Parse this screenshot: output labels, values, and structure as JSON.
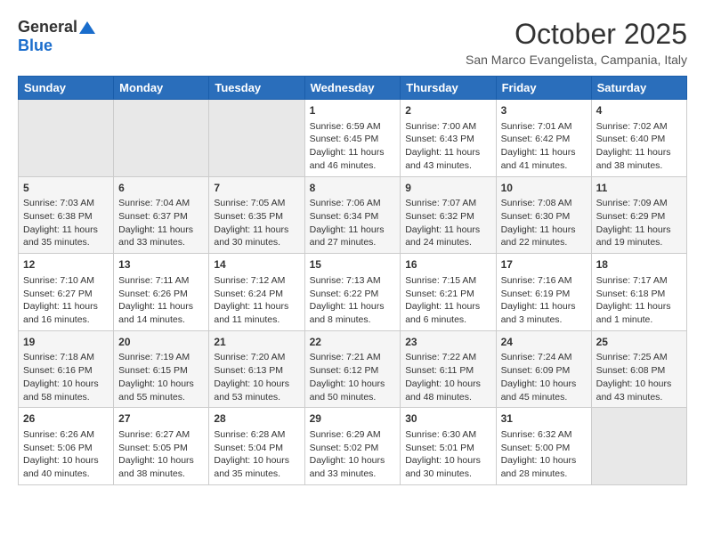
{
  "header": {
    "logo": {
      "general": "General",
      "blue": "Blue"
    },
    "title": "October 2025",
    "location": "San Marco Evangelista, Campania, Italy"
  },
  "calendar": {
    "days": [
      "Sunday",
      "Monday",
      "Tuesday",
      "Wednesday",
      "Thursday",
      "Friday",
      "Saturday"
    ],
    "weeks": [
      [
        {
          "day": "",
          "content": ""
        },
        {
          "day": "",
          "content": ""
        },
        {
          "day": "",
          "content": ""
        },
        {
          "day": "1",
          "content": "Sunrise: 6:59 AM\nSunset: 6:45 PM\nDaylight: 11 hours\nand 46 minutes."
        },
        {
          "day": "2",
          "content": "Sunrise: 7:00 AM\nSunset: 6:43 PM\nDaylight: 11 hours\nand 43 minutes."
        },
        {
          "day": "3",
          "content": "Sunrise: 7:01 AM\nSunset: 6:42 PM\nDaylight: 11 hours\nand 41 minutes."
        },
        {
          "day": "4",
          "content": "Sunrise: 7:02 AM\nSunset: 6:40 PM\nDaylight: 11 hours\nand 38 minutes."
        }
      ],
      [
        {
          "day": "5",
          "content": "Sunrise: 7:03 AM\nSunset: 6:38 PM\nDaylight: 11 hours\nand 35 minutes."
        },
        {
          "day": "6",
          "content": "Sunrise: 7:04 AM\nSunset: 6:37 PM\nDaylight: 11 hours\nand 33 minutes."
        },
        {
          "day": "7",
          "content": "Sunrise: 7:05 AM\nSunset: 6:35 PM\nDaylight: 11 hours\nand 30 minutes."
        },
        {
          "day": "8",
          "content": "Sunrise: 7:06 AM\nSunset: 6:34 PM\nDaylight: 11 hours\nand 27 minutes."
        },
        {
          "day": "9",
          "content": "Sunrise: 7:07 AM\nSunset: 6:32 PM\nDaylight: 11 hours\nand 24 minutes."
        },
        {
          "day": "10",
          "content": "Sunrise: 7:08 AM\nSunset: 6:30 PM\nDaylight: 11 hours\nand 22 minutes."
        },
        {
          "day": "11",
          "content": "Sunrise: 7:09 AM\nSunset: 6:29 PM\nDaylight: 11 hours\nand 19 minutes."
        }
      ],
      [
        {
          "day": "12",
          "content": "Sunrise: 7:10 AM\nSunset: 6:27 PM\nDaylight: 11 hours\nand 16 minutes."
        },
        {
          "day": "13",
          "content": "Sunrise: 7:11 AM\nSunset: 6:26 PM\nDaylight: 11 hours\nand 14 minutes."
        },
        {
          "day": "14",
          "content": "Sunrise: 7:12 AM\nSunset: 6:24 PM\nDaylight: 11 hours\nand 11 minutes."
        },
        {
          "day": "15",
          "content": "Sunrise: 7:13 AM\nSunset: 6:22 PM\nDaylight: 11 hours\nand 8 minutes."
        },
        {
          "day": "16",
          "content": "Sunrise: 7:15 AM\nSunset: 6:21 PM\nDaylight: 11 hours\nand 6 minutes."
        },
        {
          "day": "17",
          "content": "Sunrise: 7:16 AM\nSunset: 6:19 PM\nDaylight: 11 hours\nand 3 minutes."
        },
        {
          "day": "18",
          "content": "Sunrise: 7:17 AM\nSunset: 6:18 PM\nDaylight: 11 hours\nand 1 minute."
        }
      ],
      [
        {
          "day": "19",
          "content": "Sunrise: 7:18 AM\nSunset: 6:16 PM\nDaylight: 10 hours\nand 58 minutes."
        },
        {
          "day": "20",
          "content": "Sunrise: 7:19 AM\nSunset: 6:15 PM\nDaylight: 10 hours\nand 55 minutes."
        },
        {
          "day": "21",
          "content": "Sunrise: 7:20 AM\nSunset: 6:13 PM\nDaylight: 10 hours\nand 53 minutes."
        },
        {
          "day": "22",
          "content": "Sunrise: 7:21 AM\nSunset: 6:12 PM\nDaylight: 10 hours\nand 50 minutes."
        },
        {
          "day": "23",
          "content": "Sunrise: 7:22 AM\nSunset: 6:11 PM\nDaylight: 10 hours\nand 48 minutes."
        },
        {
          "day": "24",
          "content": "Sunrise: 7:24 AM\nSunset: 6:09 PM\nDaylight: 10 hours\nand 45 minutes."
        },
        {
          "day": "25",
          "content": "Sunrise: 7:25 AM\nSunset: 6:08 PM\nDaylight: 10 hours\nand 43 minutes."
        }
      ],
      [
        {
          "day": "26",
          "content": "Sunrise: 6:26 AM\nSunset: 5:06 PM\nDaylight: 10 hours\nand 40 minutes."
        },
        {
          "day": "27",
          "content": "Sunrise: 6:27 AM\nSunset: 5:05 PM\nDaylight: 10 hours\nand 38 minutes."
        },
        {
          "day": "28",
          "content": "Sunrise: 6:28 AM\nSunset: 5:04 PM\nDaylight: 10 hours\nand 35 minutes."
        },
        {
          "day": "29",
          "content": "Sunrise: 6:29 AM\nSunset: 5:02 PM\nDaylight: 10 hours\nand 33 minutes."
        },
        {
          "day": "30",
          "content": "Sunrise: 6:30 AM\nSunset: 5:01 PM\nDaylight: 10 hours\nand 30 minutes."
        },
        {
          "day": "31",
          "content": "Sunrise: 6:32 AM\nSunset: 5:00 PM\nDaylight: 10 hours\nand 28 minutes."
        },
        {
          "day": "",
          "content": ""
        }
      ]
    ]
  }
}
